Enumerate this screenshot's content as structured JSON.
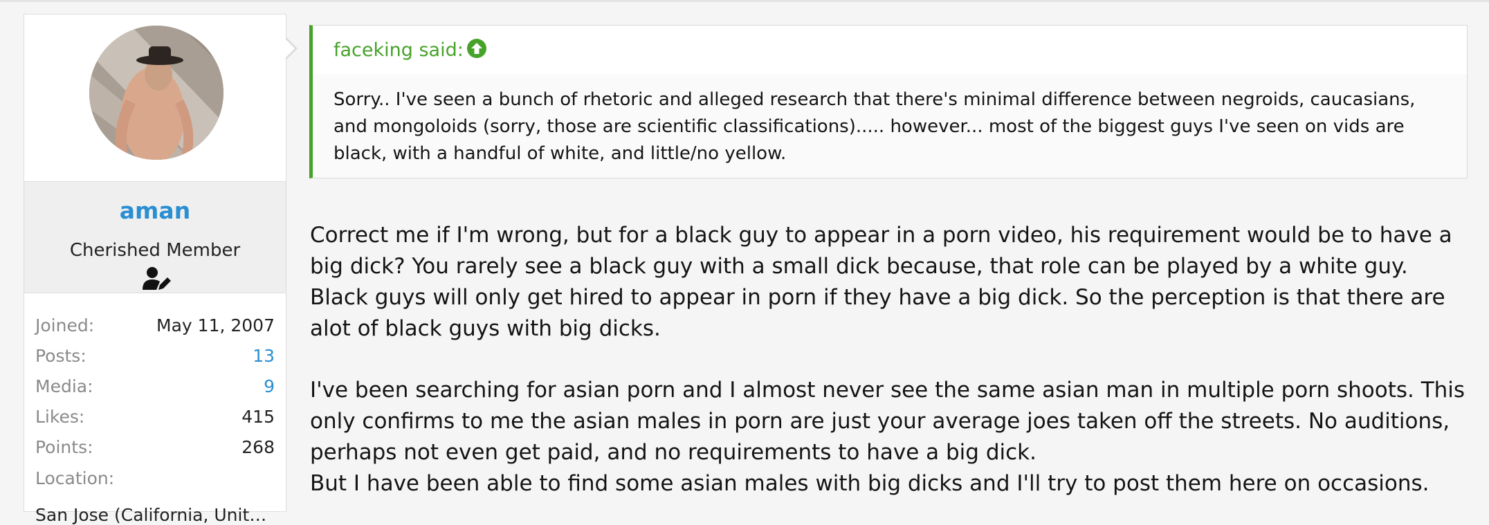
{
  "user": {
    "name": "aman",
    "title": "Cherished Member",
    "stats": [
      {
        "label": "Joined:",
        "value": "May 11, 2007",
        "link": false
      },
      {
        "label": "Posts:",
        "value": "13",
        "link": true
      },
      {
        "label": "Media:",
        "value": "9",
        "link": true
      },
      {
        "label": "Likes:",
        "value": "415",
        "link": false
      },
      {
        "label": "Points:",
        "value": "268",
        "link": false
      }
    ],
    "location_label": "Location:",
    "location_value": "San Jose (California, Unite..."
  },
  "quote": {
    "author": "faceking said:",
    "text": "Sorry.. I've seen a bunch of rhetoric and alleged research that there's minimal difference between negroids, caucasians, and mongoloids (sorry, those are scientific classifications)..... however... most of the biggest guys I've seen on vids are black, with a handful of white, and little/no yellow."
  },
  "post": {
    "paragraph1": "Correct me if I'm wrong, but for a black guy to appear in a porn video, his requirement would be to have a big dick? You rarely see a black guy with a small dick because, that role can be played by a white guy. Black guys will only get hired to appear in porn if they have a big dick. So the perception is that there are alot of black guys with big dicks.",
    "paragraph2": "I've been searching for asian porn and I almost never see the same asian man in multiple porn shoots. This only confirms to me the asian males in porn are just your average joes taken off the streets. No auditions, perhaps not even get paid, and no requirements to have a big dick.",
    "paragraph3": "But I have been able to find some asian males with big dicks and I'll try to post them here on occasions."
  },
  "colors": {
    "link": "#2a8fd2",
    "quote_accent": "#47a22a"
  },
  "icons": {
    "quote_jump": "arrow-circle-up-icon",
    "user_badge": "user-edit-icon"
  }
}
